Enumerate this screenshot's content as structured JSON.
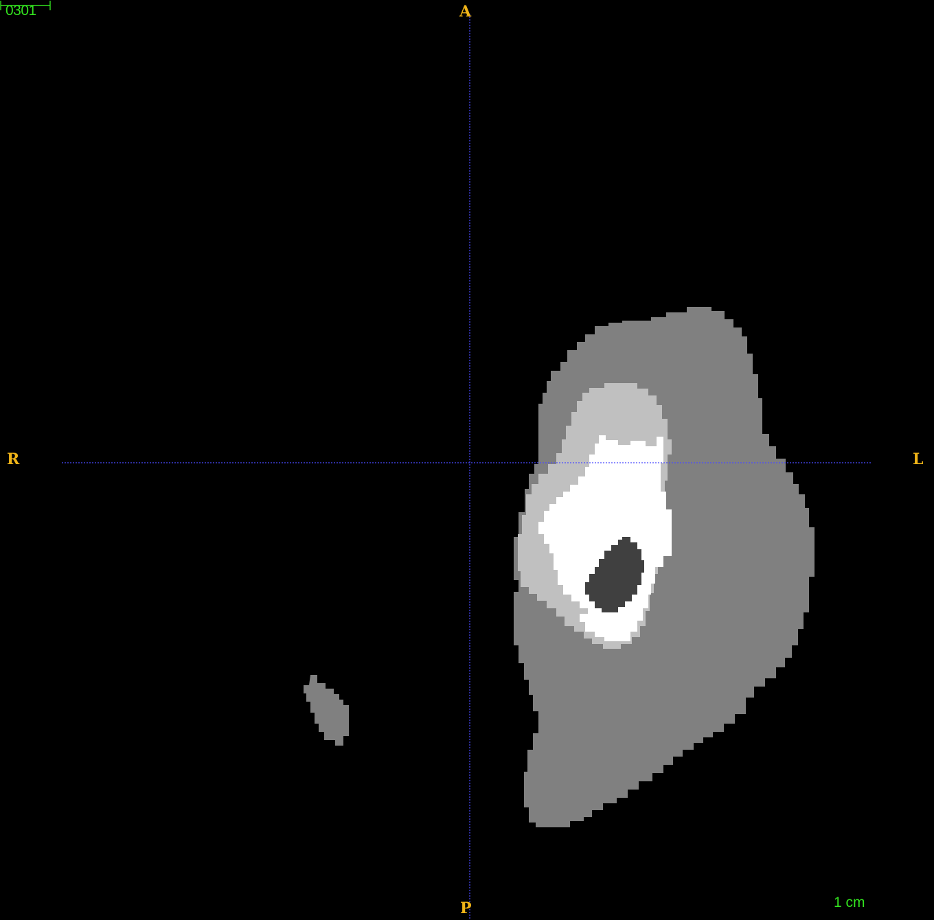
{
  "viewer": {
    "slice_number": "0301",
    "orientation": {
      "anterior": "A",
      "posterior": "P",
      "right": "R",
      "left": "L"
    },
    "scale_bar_label": "1 cm"
  },
  "colors": {
    "background": "#000000",
    "overlay_text": "#33e31f",
    "orientation_labels": "#f0b418",
    "crosshair": "#4a4aff",
    "tissue_soft": "#808080",
    "tissue_mid": "#c0c0c0",
    "tissue_bright": "#ffffff",
    "tissue_dark": "#404040"
  }
}
